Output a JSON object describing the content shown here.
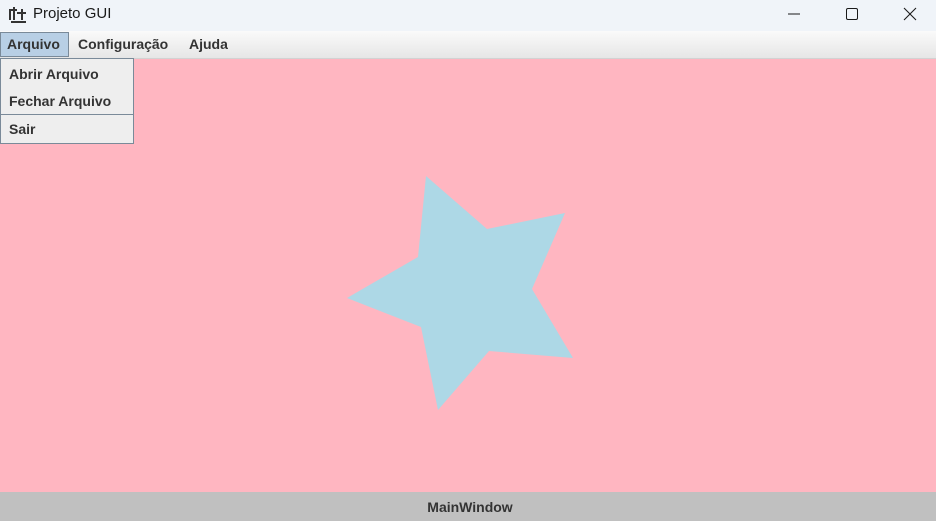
{
  "window": {
    "title": "Projeto GUI",
    "controls": [
      "minimize-icon",
      "maximize-icon",
      "close-icon"
    ]
  },
  "menubar": {
    "items": [
      {
        "label": "Arquivo",
        "open": true
      },
      {
        "label": "Configuração"
      },
      {
        "label": "Ajuda"
      }
    ]
  },
  "dropdown": {
    "items": [
      {
        "label": "Abrir Arquivo"
      },
      {
        "label": "Fechar Arquivo"
      },
      {
        "label": "Sair"
      }
    ]
  },
  "canvas": {
    "background_color": "#ffb6c1",
    "shape": "star",
    "shape_color": "#add8e6"
  },
  "statusbar": {
    "text": "MainWindow",
    "background_color": "#c0c0c0"
  }
}
